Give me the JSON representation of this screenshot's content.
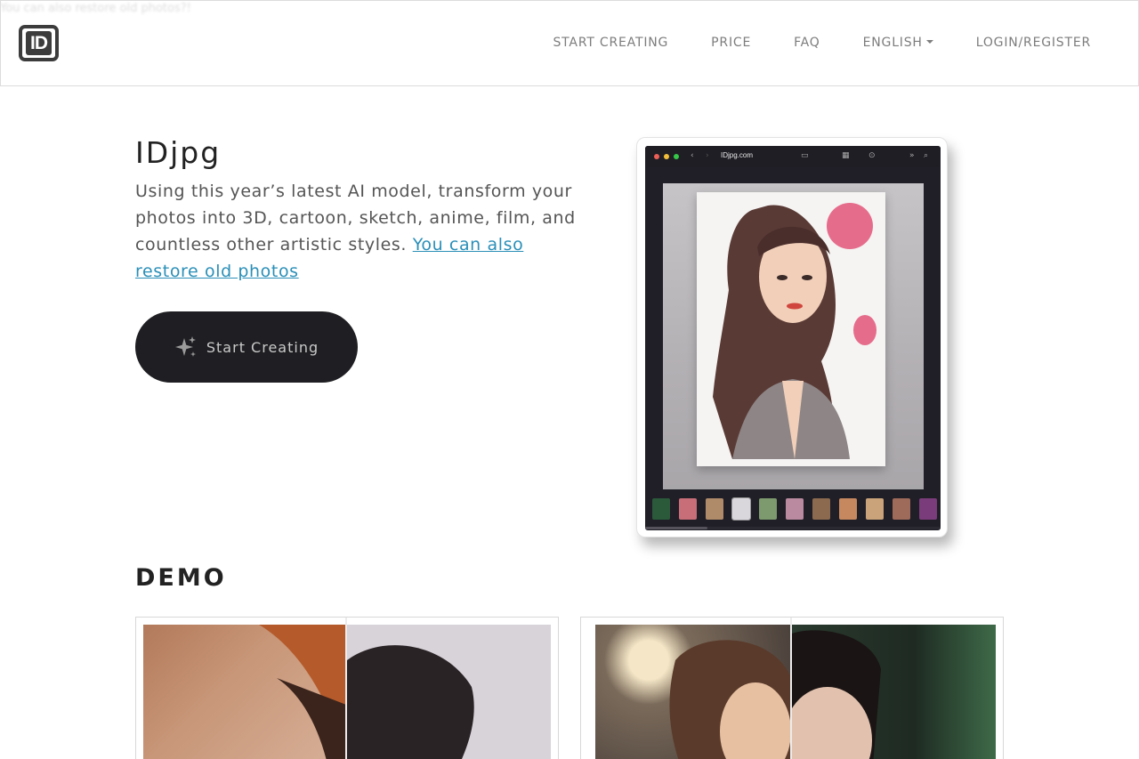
{
  "ghost_text": "You can also restore old photos?!",
  "brand": {
    "logo_text": "ID"
  },
  "nav": {
    "items": [
      {
        "label": "START CREATING"
      },
      {
        "label": "PRICE"
      },
      {
        "label": "FAQ"
      },
      {
        "label": "ENGLISH",
        "has_dropdown": true
      },
      {
        "label": "LOGIN/REGISTER"
      }
    ]
  },
  "hero": {
    "title": "IDjpg",
    "description": "Using this year’s latest AI model, transform your photos into 3D, cartoon, sketch, anime, film, and countless other artistic styles.",
    "link_text": "You can also restore old photos",
    "cta_label": "Start Creating",
    "cta_icon": "sparkles-icon"
  },
  "preview": {
    "url": "IDjpg.com",
    "window_dots": [
      "#ec5f57",
      "#f2be3a",
      "#35c748"
    ]
  },
  "demo": {
    "title": "DEMO"
  },
  "colors": {
    "accent_link": "#2a8fb8",
    "cta_background": "#1f1e22",
    "nav_text": "#7d7d7d"
  }
}
